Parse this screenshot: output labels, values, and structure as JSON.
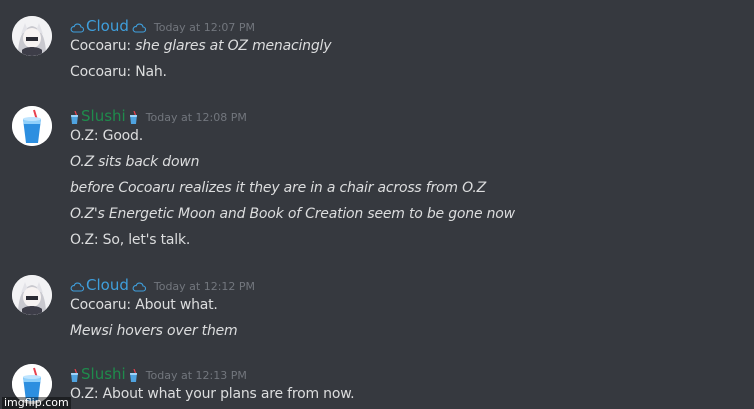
{
  "messages": [
    {
      "username": "Cloud",
      "username_color": "#3f9fdc",
      "emoji": "cloud-icon",
      "avatar": "white-haired-character-avatar",
      "timestamp": "Today at 12:07 PM",
      "lines": [
        {
          "speaker": "Cocoaru: ",
          "text": "she glares at OZ menacingly",
          "italic": true
        },
        {
          "speaker": "Cocoaru: ",
          "text": "Nah.",
          "italic": false
        }
      ]
    },
    {
      "username": "Slushi",
      "username_color": "#1f8b4c",
      "emoji": "cup-icon",
      "avatar": "blue-slushie-avatar",
      "timestamp": "Today at 12:08 PM",
      "lines": [
        {
          "speaker": "O.Z: ",
          "text": "Good.",
          "italic": false
        },
        {
          "speaker": "",
          "text": "O.Z sits back down",
          "italic": true
        },
        {
          "speaker": "",
          "text": "before Cocoaru realizes it they are in a chair across from O.Z",
          "italic": true
        },
        {
          "speaker": "",
          "text": "O.Z's Energetic Moon and Book of Creation seem to be gone now",
          "italic": true
        },
        {
          "speaker": "O.Z: ",
          "text": "So, let's talk.",
          "italic": false
        }
      ]
    },
    {
      "username": "Cloud",
      "username_color": "#3f9fdc",
      "emoji": "cloud-icon",
      "avatar": "white-haired-character-avatar",
      "timestamp": "Today at 12:12 PM",
      "lines": [
        {
          "speaker": "Cocoaru: ",
          "text": "About what.",
          "italic": false
        },
        {
          "speaker": "",
          "text": "Mewsi hovers over them",
          "italic": true
        }
      ]
    },
    {
      "username": "Slushi",
      "username_color": "#1f8b4c",
      "emoji": "cup-icon",
      "avatar": "blue-slushie-avatar",
      "timestamp": "Today at 12:13 PM",
      "lines": [
        {
          "speaker": "O.Z: ",
          "text": "About what your plans are from now.",
          "italic": false
        }
      ]
    }
  ],
  "watermark": "imgflip.com"
}
